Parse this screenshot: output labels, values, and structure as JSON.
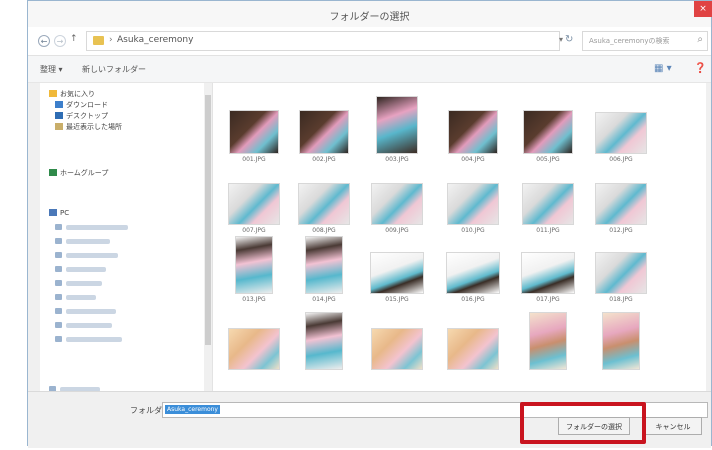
{
  "window": {
    "title": "フォルダーの選択",
    "close_label": "×"
  },
  "nav": {
    "back": "←",
    "forward": "→",
    "up": "↑",
    "path_sep": "›",
    "path": "Asuka_ceremony",
    "dropdown": "▾",
    "refresh": "↻",
    "search_placeholder": "Asuka_ceremonyの検索",
    "search_icon": "magnifier-icon"
  },
  "toolbar": {
    "organize": "整理 ▾",
    "new_folder": "新しいフォルダー",
    "view_icon": "view-icon",
    "help_icon": "help-icon"
  },
  "sidebar": {
    "favorites": "お気に入り",
    "downloads": "ダウンロード",
    "desktop": "デスクトップ",
    "recent": "最近表示した場所",
    "homegroup": "ホームグループ",
    "pc": "PC"
  },
  "files": [
    {
      "name": "001.JPG",
      "tone": "dark"
    },
    {
      "name": "002.JPG",
      "tone": "dark"
    },
    {
      "name": "003.JPG",
      "tone": "portrait-dark"
    },
    {
      "name": "004.JPG",
      "tone": "dark"
    },
    {
      "name": "005.JPG",
      "tone": "dark"
    },
    {
      "name": "006.JPG",
      "tone": "light"
    },
    {
      "name": "007.JPG",
      "tone": "light"
    },
    {
      "name": "008.JPG",
      "tone": "light"
    },
    {
      "name": "009.JPG",
      "tone": "light"
    },
    {
      "name": "010.JPG",
      "tone": "light"
    },
    {
      "name": "011.JPG",
      "tone": "light"
    },
    {
      "name": "012.JPG",
      "tone": "light"
    },
    {
      "name": "013.JPG",
      "tone": "portrait-light"
    },
    {
      "name": "014.JPG",
      "tone": "portrait-light"
    },
    {
      "name": "015.JPG",
      "tone": "frame"
    },
    {
      "name": "016.JPG",
      "tone": "frame"
    },
    {
      "name": "017.JPG",
      "tone": "frame"
    },
    {
      "name": "018.JPG",
      "tone": "light"
    },
    {
      "name": "",
      "tone": "warm"
    },
    {
      "name": "",
      "tone": "portrait-light"
    },
    {
      "name": "",
      "tone": "warm"
    },
    {
      "name": "",
      "tone": "warm"
    },
    {
      "name": "",
      "tone": "portrait-warm"
    },
    {
      "name": "",
      "tone": "portrait-warm"
    }
  ],
  "footer": {
    "folder_label": "フォルダー:",
    "folder_value": "Asuka_ceremony",
    "select_button": "フォルダーの選択",
    "cancel_button": "キャンセル"
  },
  "colors": {
    "highlight": "#c9141f",
    "selection": "#3b8ed9",
    "close": "#e04343"
  }
}
